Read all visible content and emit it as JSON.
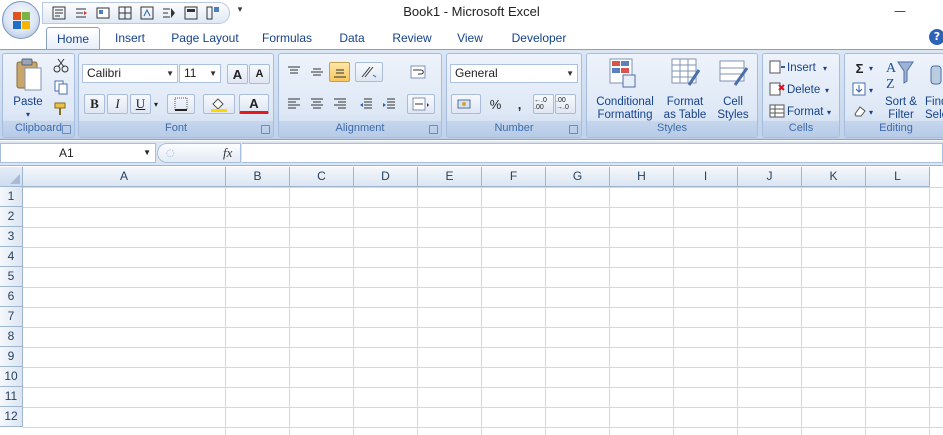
{
  "window": {
    "title": "Book1 - Microsoft Excel",
    "minimize_glyph": "—"
  },
  "qat": {
    "more_glyph": "▾"
  },
  "tabs": [
    {
      "label": "Home",
      "active": true
    },
    {
      "label": "Insert"
    },
    {
      "label": "Page Layout"
    },
    {
      "label": "Formulas"
    },
    {
      "label": "Data"
    },
    {
      "label": "Review"
    },
    {
      "label": "View"
    },
    {
      "label": "Developer"
    }
  ],
  "help": {
    "glyph": "?"
  },
  "clipboard": {
    "paste_label": "Paste",
    "group_label": "Clipboard"
  },
  "font": {
    "font_name": "Calibri",
    "font_size": "11",
    "grow_label": "A",
    "shrink_label": "A",
    "bold": "B",
    "italic": "I",
    "underline": "U",
    "font_color_label": "A",
    "group_label": "Font"
  },
  "alignment": {
    "group_label": "Alignment"
  },
  "number": {
    "format": "General",
    "percent": "%",
    "comma": ",",
    "increase_decimal": "←.0 .00",
    "decrease_decimal": ".00 →.0",
    "group_label": "Number"
  },
  "styles": {
    "conditional_line1": "Conditional",
    "conditional_line2": "Formatting",
    "table_line1": "Format",
    "table_line2": "as Table",
    "cell_line1": "Cell",
    "cell_line2": "Styles",
    "group_label": "Styles"
  },
  "cells": {
    "insert_label": "Insert",
    "delete_label": "Delete",
    "format_label": "Format",
    "group_label": "Cells"
  },
  "editing": {
    "sum_glyph": "Σ",
    "sort_line1": "Sort &",
    "sort_line2": "Filter",
    "find_line1": "Find",
    "find_line2": "Sele",
    "group_label": "Editing"
  },
  "formula_bar": {
    "name_box": "A1",
    "fx": "fx",
    "formula": ""
  },
  "grid": {
    "columns": [
      "A",
      "B",
      "C",
      "D",
      "E",
      "F",
      "G",
      "H",
      "I",
      "J",
      "K",
      "L"
    ],
    "rows": [
      "1",
      "2",
      "3",
      "4",
      "5",
      "6",
      "7",
      "8",
      "9",
      "10",
      "11",
      "12"
    ]
  },
  "colors": {
    "ribbon_text": "#15428b",
    "grid_line": "#d0d7e5",
    "header_border": "#9eb6ce"
  }
}
